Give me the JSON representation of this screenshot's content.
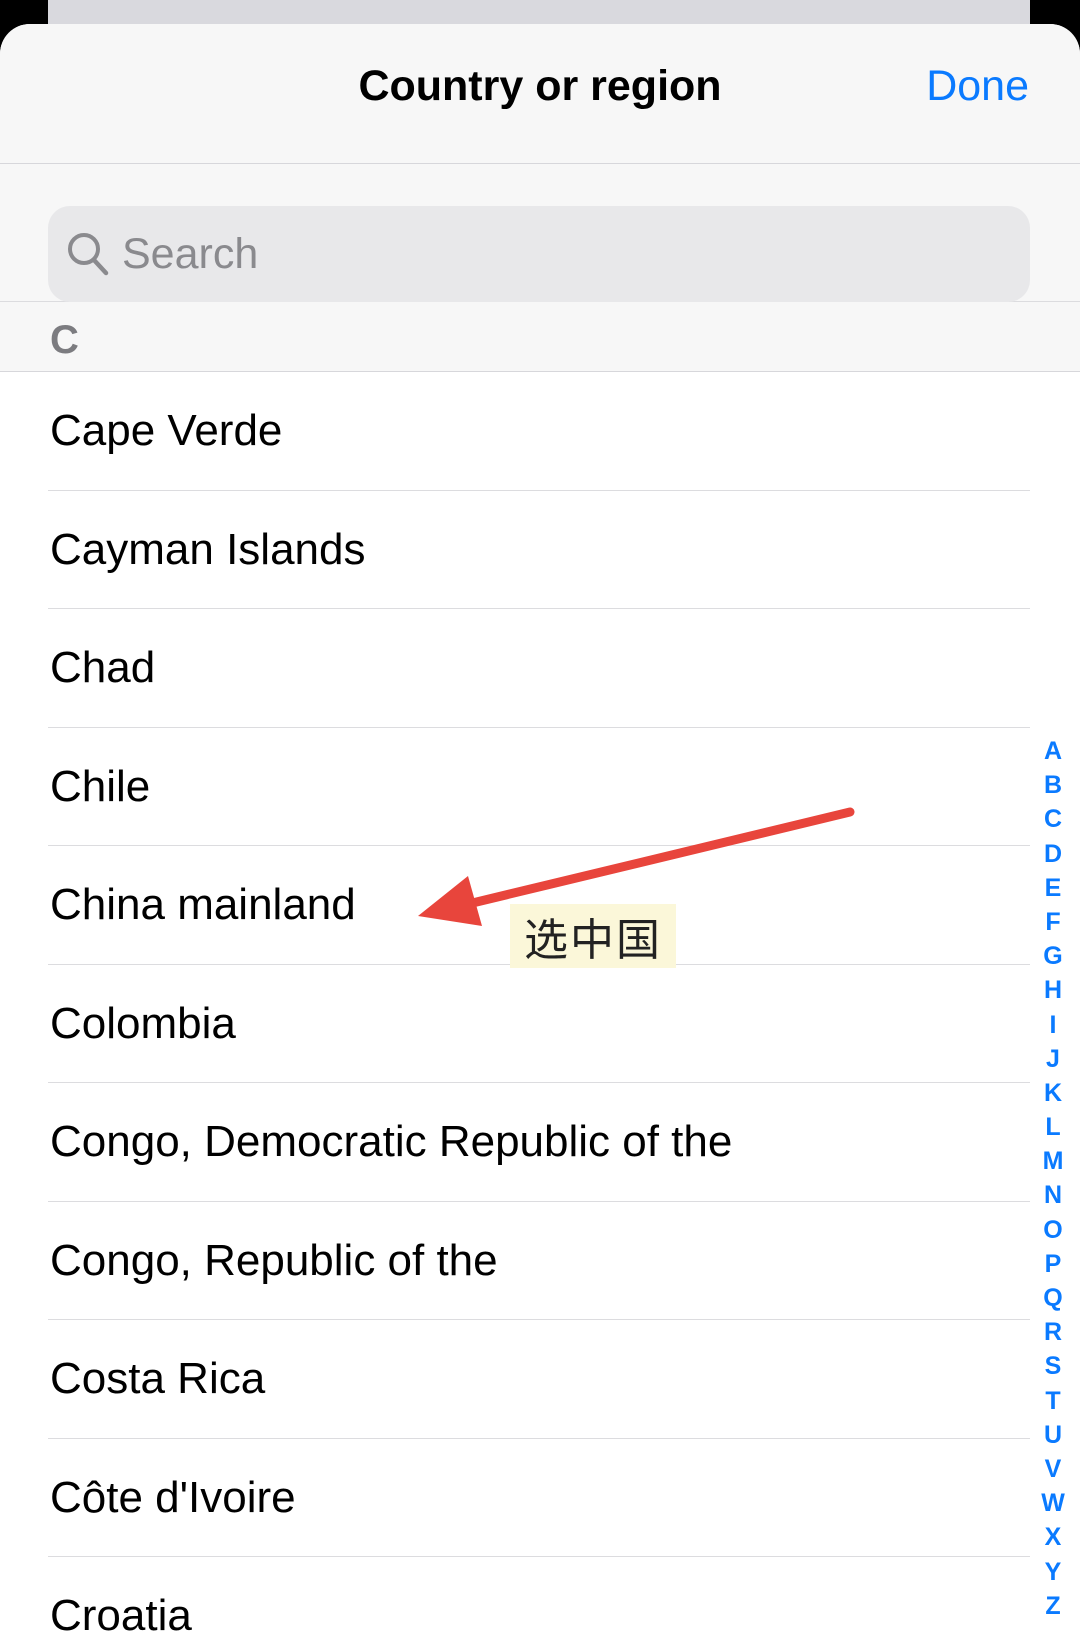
{
  "header": {
    "title": "Country or region",
    "done_label": "Done"
  },
  "search": {
    "placeholder": "Search"
  },
  "section": {
    "letter": "C"
  },
  "countries": [
    "Cape Verde",
    "Cayman Islands",
    "Chad",
    "Chile",
    "China mainland",
    "Colombia",
    "Congo, Democratic Republic of the",
    "Congo, Republic of the",
    "Costa Rica",
    "Côte d'Ivoire",
    "Croatia"
  ],
  "index_letters": [
    "A",
    "B",
    "C",
    "D",
    "E",
    "F",
    "G",
    "H",
    "I",
    "J",
    "K",
    "L",
    "M",
    "N",
    "O",
    "P",
    "Q",
    "R",
    "S",
    "T",
    "U",
    "V",
    "W",
    "X",
    "Y",
    "Z"
  ],
  "annotation": {
    "text": "选中国",
    "arrow_color": "#e8453c"
  },
  "colors": {
    "accent": "#0a7aff",
    "annotation_arrow": "#e8453c",
    "note_bg": "#fbf7d9"
  },
  "icons": {
    "search": "search-icon",
    "arrow": "arrow-icon"
  }
}
